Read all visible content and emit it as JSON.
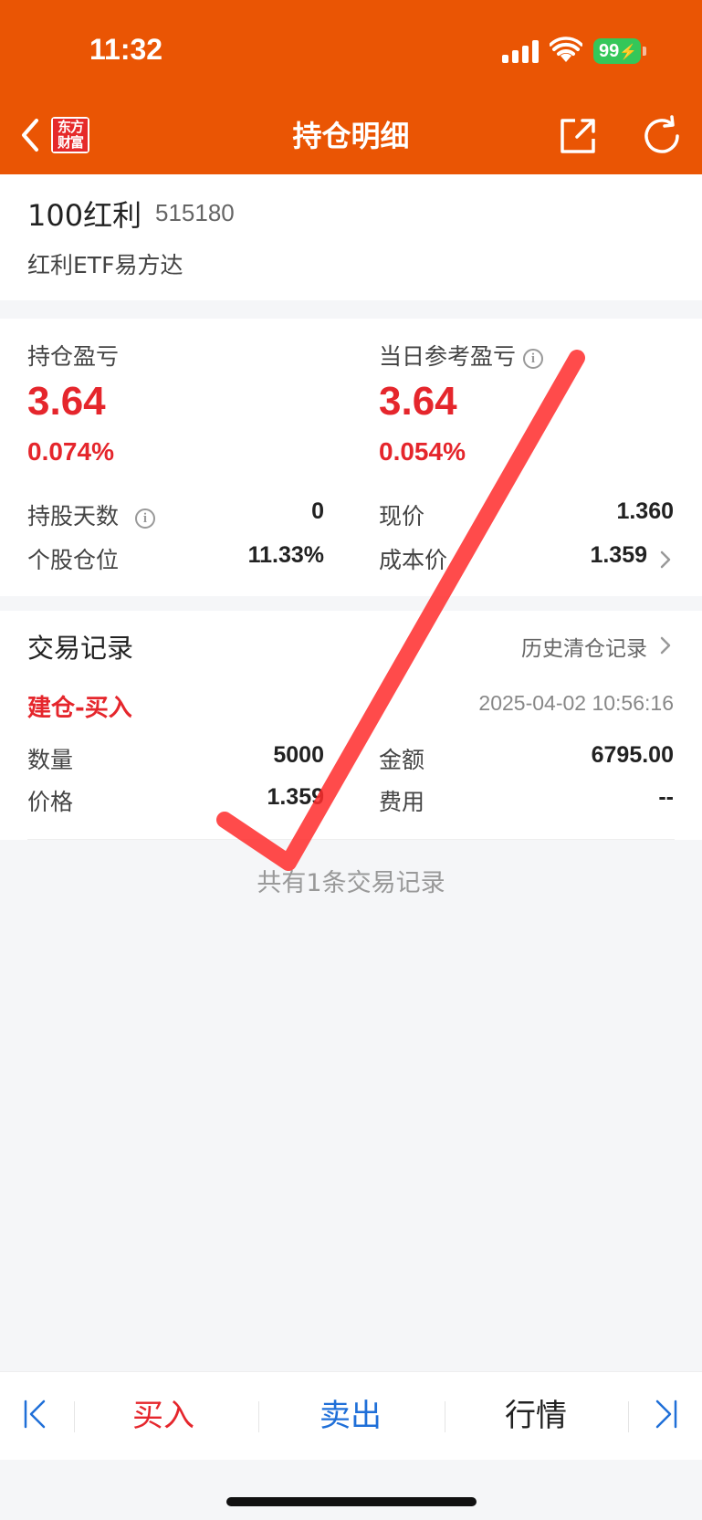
{
  "status_bar": {
    "time": "11:32",
    "battery": "99"
  },
  "nav": {
    "title": "持仓明细",
    "logo_line1": "东方",
    "logo_line2": "财富"
  },
  "stock": {
    "name": "100红利",
    "code": "515180",
    "full_name": "红利ETF易方达"
  },
  "position": {
    "holding_pl_label": "持仓盈亏",
    "holding_pl_value": "3.64",
    "holding_pl_pct": "0.074%",
    "daily_pl_label": "当日参考盈亏",
    "daily_pl_value": "3.64",
    "daily_pl_pct": "0.054%",
    "days_label": "持股天数",
    "days_value": "0",
    "ratio_label": "个股仓位",
    "ratio_value": "11.33%",
    "price_label": "现价",
    "price_value": "1.360",
    "cost_label": "成本价",
    "cost_value": "1.359"
  },
  "trade": {
    "section_title": "交易记录",
    "history_link": "历史清仓记录",
    "type": "建仓-买入",
    "datetime": "2025-04-02 10:56:16",
    "qty_label": "数量",
    "qty_value": "5000",
    "amount_label": "金额",
    "amount_value": "6795.00",
    "price_label": "价格",
    "price_value": "1.359",
    "fee_label": "费用",
    "fee_value": "--",
    "count_text": "共有1条交易记录"
  },
  "bottom_bar": {
    "buy": "买入",
    "sell": "卖出",
    "quote": "行情"
  },
  "colors": {
    "header": "#ea5504",
    "gain": "#e5262c",
    "sell": "#1f6fd8",
    "battery": "#34c759"
  },
  "icons": [
    "back-icon",
    "share-icon",
    "refresh-icon",
    "info-icon",
    "chevron-right-icon",
    "first-page-icon",
    "last-page-icon"
  ]
}
